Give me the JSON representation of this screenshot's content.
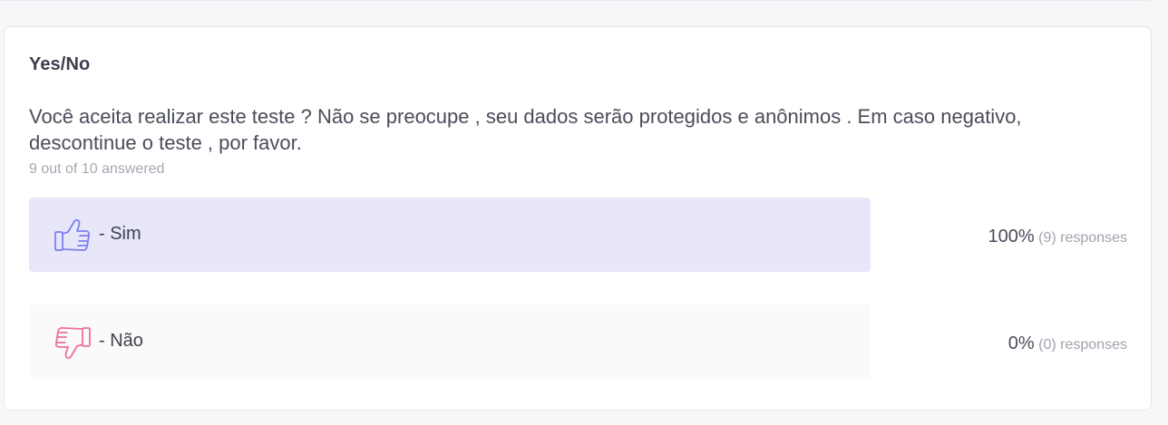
{
  "question": {
    "type_label": "Yes/No",
    "text": "Você aceita realizar este teste ? Não se preocupe , seu dados serão protegidos e anônimos . Em caso negativo, descontinue o teste , por favor.",
    "answered": "9 out of 10 answered"
  },
  "options": [
    {
      "label": "- Sim",
      "icon": "thumbs-up-icon",
      "percent": "100%",
      "count": "(9)",
      "responses_word": "responses",
      "fraction": 1.0,
      "color": "#7b7ff0",
      "bg": "#e8e7f9"
    },
    {
      "label": "- Não",
      "icon": "thumbs-down-icon",
      "percent": "0%",
      "count": "(0)",
      "responses_word": "responses",
      "fraction": 0.0,
      "color": "#ef6f9a",
      "bg": "#fafafa"
    }
  ]
}
